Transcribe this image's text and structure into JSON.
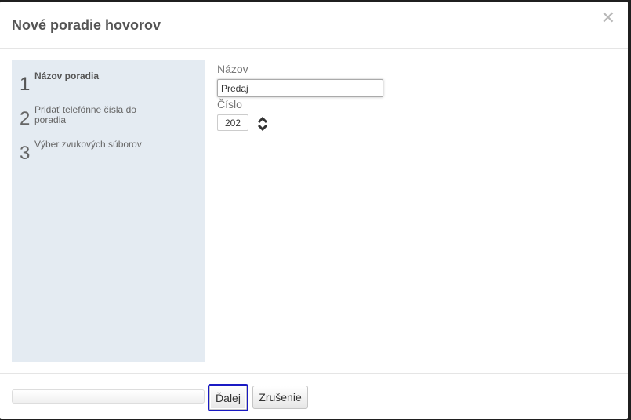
{
  "dialog": {
    "title": "Nové poradie hovorov",
    "close_glyph": "✕"
  },
  "steps": [
    {
      "number": "1",
      "label": "Názov poradia",
      "active": true
    },
    {
      "number": "2",
      "label": "Pridať telefónne čísla do poradia",
      "active": false
    },
    {
      "number": "3",
      "label": "Výber zvukových súborov",
      "active": false
    }
  ],
  "form": {
    "name_label": "Názov",
    "name_value": "Predaj",
    "number_label": "Číslo",
    "number_value": "202"
  },
  "footer": {
    "next_label": "Ďalej",
    "cancel_label": "Zrušenie"
  },
  "icons": {
    "close": "close-icon",
    "spinner": "spinner-up-down-icon"
  },
  "colors": {
    "steps_background": "#e4ebf2",
    "focus_outline": "#1a1ac4"
  }
}
